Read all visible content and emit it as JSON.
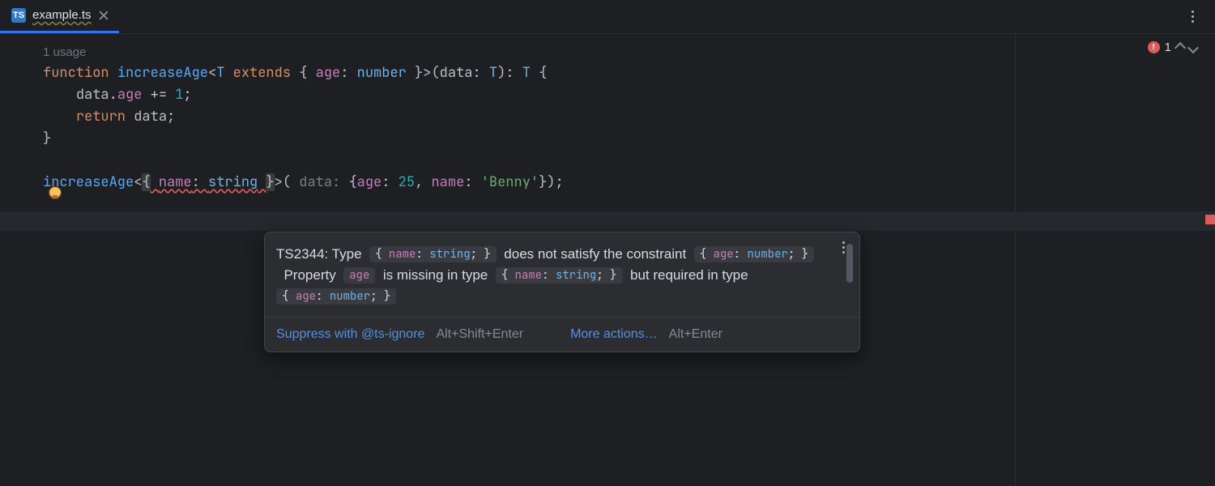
{
  "tab": {
    "icon_label": "TS",
    "filename": "example.ts",
    "active": true
  },
  "problems": {
    "count": 1
  },
  "usages_hint": "1 usage",
  "code_tokens": {
    "function": "function",
    "fn_name": "increaseAge",
    "extends": "extends",
    "age": "age",
    "number": "number",
    "data": "data",
    "T": "T",
    "return": "return",
    "one": "1",
    "name": "name",
    "string": "string",
    "age_val": "25",
    "name_val": "'Benny'",
    "param_hint": "data:"
  },
  "tooltip": {
    "code": "TS2344",
    "text": {
      "type_pre": ": Type",
      "nosat": "does not satisfy the constraint",
      "prop": "Property",
      "missing": "is missing in type",
      "required": "but required in type"
    },
    "chips": {
      "name_string": "{ name: string; }",
      "age_number": "{ age: number; }",
      "age": "age"
    },
    "actions": {
      "suppress": "Suppress with @ts-ignore",
      "suppress_sc": "Alt+Shift+Enter",
      "more": "More actions…",
      "more_sc": "Alt+Enter"
    }
  }
}
